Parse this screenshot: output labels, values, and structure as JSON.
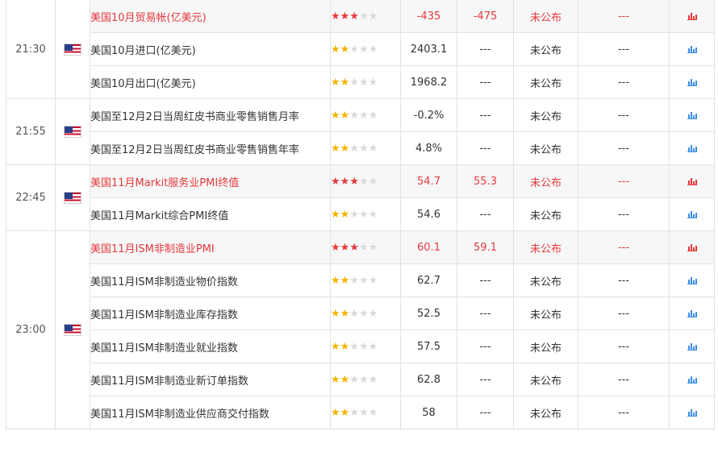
{
  "groups": [
    {
      "time": "21:30",
      "country_icon": "us-flag-icon",
      "rows": [
        {
          "event": "美国10月贸易帐(亿美元)",
          "importance_stars": 3,
          "previous": "-435",
          "forecast": "-475",
          "actual": "未公布",
          "impact": "---",
          "highlight": true
        },
        {
          "event": "美国10月进口(亿美元)",
          "importance_stars": 2,
          "previous": "2403.1",
          "forecast": "---",
          "actual": "未公布",
          "impact": "---",
          "highlight": false
        },
        {
          "event": "美国10月出口(亿美元)",
          "importance_stars": 2,
          "previous": "1968.2",
          "forecast": "---",
          "actual": "未公布",
          "impact": "---",
          "highlight": false
        }
      ]
    },
    {
      "time": "21:55",
      "country_icon": "us-flag-icon",
      "rows": [
        {
          "event": "美国至12月2日当周红皮书商业零售销售月率",
          "importance_stars": 2,
          "previous": "-0.2%",
          "forecast": "---",
          "actual": "未公布",
          "impact": "---",
          "highlight": false
        },
        {
          "event": "美国至12月2日当周红皮书商业零售销售年率",
          "importance_stars": 2,
          "previous": "4.8%",
          "forecast": "---",
          "actual": "未公布",
          "impact": "---",
          "highlight": false
        }
      ]
    },
    {
      "time": "22:45",
      "country_icon": "us-flag-icon",
      "rows": [
        {
          "event": "美国11月Markit服务业PMI终值",
          "importance_stars": 3,
          "previous": "54.7",
          "forecast": "55.3",
          "actual": "未公布",
          "impact": "---",
          "highlight": true
        },
        {
          "event": "美国11月Markit综合PMI终值",
          "importance_stars": 2,
          "previous": "54.6",
          "forecast": "---",
          "actual": "未公布",
          "impact": "---",
          "highlight": false
        }
      ]
    },
    {
      "time": "23:00",
      "country_icon": "us-flag-icon",
      "rows": [
        {
          "event": "美国11月ISM非制造业PMI",
          "importance_stars": 3,
          "previous": "60.1",
          "forecast": "59.1",
          "actual": "未公布",
          "impact": "---",
          "highlight": true
        },
        {
          "event": "美国11月ISM非制造业物价指数",
          "importance_stars": 2,
          "previous": "62.7",
          "forecast": "---",
          "actual": "未公布",
          "impact": "---",
          "highlight": false
        },
        {
          "event": "美国11月ISM非制造业库存指数",
          "importance_stars": 2,
          "previous": "52.5",
          "forecast": "---",
          "actual": "未公布",
          "impact": "---",
          "highlight": false
        },
        {
          "event": "美国11月ISM非制造业就业指数",
          "importance_stars": 2,
          "previous": "57.5",
          "forecast": "---",
          "actual": "未公布",
          "impact": "---",
          "highlight": false
        },
        {
          "event": "美国11月ISM非制造业新订单指数",
          "importance_stars": 2,
          "previous": "62.8",
          "forecast": "---",
          "actual": "未公布",
          "impact": "---",
          "highlight": false
        },
        {
          "event": "美国11月ISM非制造业供应商交付指数",
          "importance_stars": 2,
          "previous": "58",
          "forecast": "---",
          "actual": "未公布",
          "impact": "---",
          "highlight": false
        }
      ]
    }
  ],
  "star_max": 5,
  "colors": {
    "highlight_red": "#e4393c",
    "star_yellow": "#f4b400",
    "star_empty": "#d9d9d9",
    "chart_blue": "#3d8ee8"
  }
}
